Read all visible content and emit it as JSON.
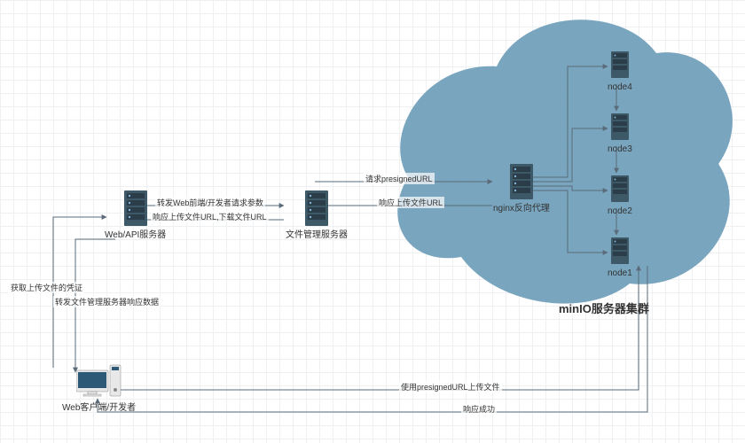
{
  "nodes": {
    "client": {
      "label": "Web客户端/开发者"
    },
    "webapi": {
      "label": "Web/API服务器"
    },
    "filemgr": {
      "label": "文件管理服务器"
    },
    "nginx": {
      "label": "nginx反向代理"
    },
    "n1": {
      "label": "node1"
    },
    "n2": {
      "label": "node2"
    },
    "n3": {
      "label": "node3"
    },
    "n4": {
      "label": "node4"
    }
  },
  "edges": {
    "client_to_webapi_1": "获取上传文件的凭证",
    "webapi_to_client_1": "转发文件管理服务器响应数据",
    "webapi_to_filemgr_1": "转发Web前端/开发者请求参数",
    "filemgr_to_webapi_1": "响应上传文件URL,下载文件URL",
    "filemgr_to_nginx_1": "请求presignedURL",
    "nginx_to_filemgr_1": "响应上传文件URL",
    "client_to_node1_1": "使用presignedURL上传文件",
    "node1_to_client_1": "响应成功"
  },
  "cluster": {
    "title": "minIO服务器集群"
  },
  "chart_data": {
    "type": "diagram",
    "title": "minIO服务器集群 object-storage upload flow",
    "nodes": [
      {
        "id": "client",
        "label": "Web客户端/开发者",
        "kind": "desktop"
      },
      {
        "id": "webapi",
        "label": "Web/API服务器",
        "kind": "server"
      },
      {
        "id": "filemgr",
        "label": "文件管理服务器",
        "kind": "server"
      },
      {
        "id": "nginx",
        "label": "nginx反向代理",
        "kind": "server"
      },
      {
        "id": "node1",
        "label": "node1",
        "kind": "server",
        "group": "minIO"
      },
      {
        "id": "node2",
        "label": "node2",
        "kind": "server",
        "group": "minIO"
      },
      {
        "id": "node3",
        "label": "node3",
        "kind": "server",
        "group": "minIO"
      },
      {
        "id": "node4",
        "label": "node4",
        "kind": "server",
        "group": "minIO"
      }
    ],
    "groups": [
      {
        "id": "minIO",
        "label": "minIO服务器集群",
        "members": [
          "node1",
          "node2",
          "node3",
          "node4"
        ]
      }
    ],
    "edges": [
      {
        "from": "client",
        "to": "webapi",
        "label": "获取上传文件的凭证"
      },
      {
        "from": "webapi",
        "to": "client",
        "label": "转发文件管理服务器响应数据"
      },
      {
        "from": "webapi",
        "to": "filemgr",
        "label": "转发Web前端/开发者请求参数"
      },
      {
        "from": "filemgr",
        "to": "webapi",
        "label": "响应上传文件URL,下载文件URL"
      },
      {
        "from": "filemgr",
        "to": "nginx",
        "label": "请求presignedURL"
      },
      {
        "from": "nginx",
        "to": "filemgr",
        "label": "响应上传文件URL"
      },
      {
        "from": "nginx",
        "to": "node1",
        "label": ""
      },
      {
        "from": "nginx",
        "to": "node2",
        "label": ""
      },
      {
        "from": "nginx",
        "to": "node3",
        "label": ""
      },
      {
        "from": "nginx",
        "to": "node4",
        "label": ""
      },
      {
        "from": "node4",
        "to": "node3",
        "label": ""
      },
      {
        "from": "node3",
        "to": "node2",
        "label": ""
      },
      {
        "from": "node2",
        "to": "node1",
        "label": ""
      },
      {
        "from": "client",
        "to": "node1",
        "label": "使用presignedURL上传文件"
      },
      {
        "from": "node1",
        "to": "client",
        "label": "响应成功"
      }
    ]
  }
}
